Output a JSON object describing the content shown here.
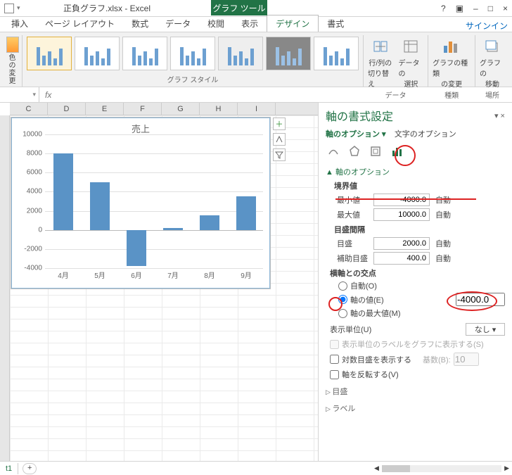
{
  "titlebar": {
    "title": "正負グラフ.xlsx - Excel",
    "tooltab": "グラフ ツール",
    "help": "?",
    "restore": "▣",
    "min": "–",
    "max": "□",
    "close": "×"
  },
  "tabs": {
    "insert": "挿入",
    "layout": "ページ レイアウト",
    "formula": "数式",
    "data": "データ",
    "review": "校閲",
    "view": "表示",
    "design": "デザイン",
    "format": "書式",
    "signin": "サインイン"
  },
  "ribbon": {
    "color_btn_top": "色の",
    "color_btn_bot": "変更",
    "styles_label": "グラフ スタイル",
    "switch_top": "行/列の",
    "switch_bot": "切り替え",
    "select_top": "データの",
    "select_bot": "選択",
    "data_label": "データ",
    "type_top": "グラフの種類",
    "type_bot": "の変更",
    "type_label": "種類",
    "move_top": "グラフの",
    "move_bot": "移動",
    "loc_label": "場所"
  },
  "cols": [
    "C",
    "D",
    "E",
    "F",
    "G",
    "H",
    "I"
  ],
  "pane": {
    "title": "軸の書式設定",
    "opt_main": "軸のオプション ▾",
    "opt_text": "文字のオプション",
    "section_axis_opt": "軸のオプション",
    "bounds": "境界値",
    "min_lbl": "最小値",
    "min_val": "-4000.0",
    "max_lbl": "最大値",
    "max_val": "10000.0",
    "major_section": "目盛間隔",
    "major_lbl": "目盛",
    "major_val": "2000.0",
    "minor_lbl": "補助目盛",
    "minor_val": "400.0",
    "auto": "自動",
    "cross": "横軸との交点",
    "cross_auto": "自動(O)",
    "cross_val": "軸の値(E)",
    "cross_val_v": "-4000.0",
    "cross_max": "軸の最大値(M)",
    "disp_unit": "表示単位(U)",
    "disp_unit_v": "なし",
    "disp_unit_chk": "表示単位のラベルをグラフに表示する(S)",
    "log": "対数目盛を表示する",
    "log_base_lbl": "基数(B):",
    "log_base_v": "10",
    "reverse": "軸を反転する(V)",
    "exp_tick": "目盛",
    "exp_label": "ラベル"
  },
  "sheet": {
    "tab": "t1",
    "plus": "+"
  },
  "chart_data": {
    "type": "bar",
    "title": "売上",
    "categories": [
      "4月",
      "5月",
      "6月",
      "7月",
      "8月",
      "9月"
    ],
    "values": [
      8000,
      5000,
      -3800,
      200,
      1500,
      3500
    ],
    "ylim": [
      -4000,
      10000
    ],
    "y_major": 2000,
    "xlabel": "",
    "ylabel": ""
  }
}
